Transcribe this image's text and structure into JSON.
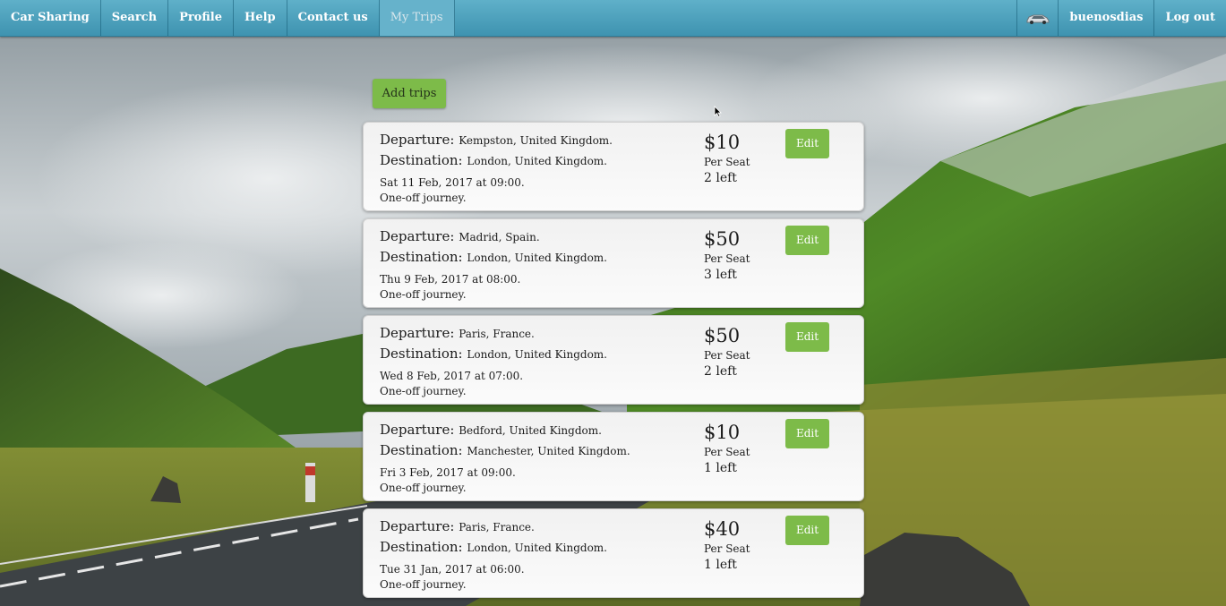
{
  "nav": {
    "brand": "Car Sharing",
    "search": "Search",
    "profile": "Profile",
    "help": "Help",
    "contact": "Contact us",
    "my_trips": "My Trips",
    "username": "buenosdias",
    "logout": "Log out",
    "car_icon": "car-icon"
  },
  "add_trips_label": "Add trips",
  "labels": {
    "departure": "Departure:",
    "destination": "Destination:",
    "per_seat": "Per Seat",
    "edit": "Edit"
  },
  "trips": [
    {
      "departure": "Kempston, United Kingdom.",
      "destination": "London, United Kingdom.",
      "datetime": "Sat 11 Feb, 2017 at 09:00.",
      "type": "One-off journey.",
      "price": "$10",
      "seats": "2 left"
    },
    {
      "departure": "Madrid, Spain.",
      "destination": "London, United Kingdom.",
      "datetime": "Thu 9 Feb, 2017 at 08:00.",
      "type": "One-off journey.",
      "price": "$50",
      "seats": "3 left"
    },
    {
      "departure": "Paris, France.",
      "destination": "London, United Kingdom.",
      "datetime": "Wed 8 Feb, 2017 at 07:00.",
      "type": "One-off journey.",
      "price": "$50",
      "seats": "2 left"
    },
    {
      "departure": "Bedford, United Kingdom.",
      "destination": "Manchester, United Kingdom.",
      "datetime": "Fri 3 Feb, 2017 at 09:00.",
      "type": "One-off journey.",
      "price": "$10",
      "seats": "1 left"
    },
    {
      "departure": "Paris, France.",
      "destination": "London, United Kingdom.",
      "datetime": "Tue 31 Jan, 2017 at 06:00.",
      "type": "One-off journey.",
      "price": "$40",
      "seats": "1 left"
    }
  ],
  "colors": {
    "navbar": "#4aa3c0",
    "button_green": "#7dbb49",
    "card_bg": "#f6f6f6"
  }
}
